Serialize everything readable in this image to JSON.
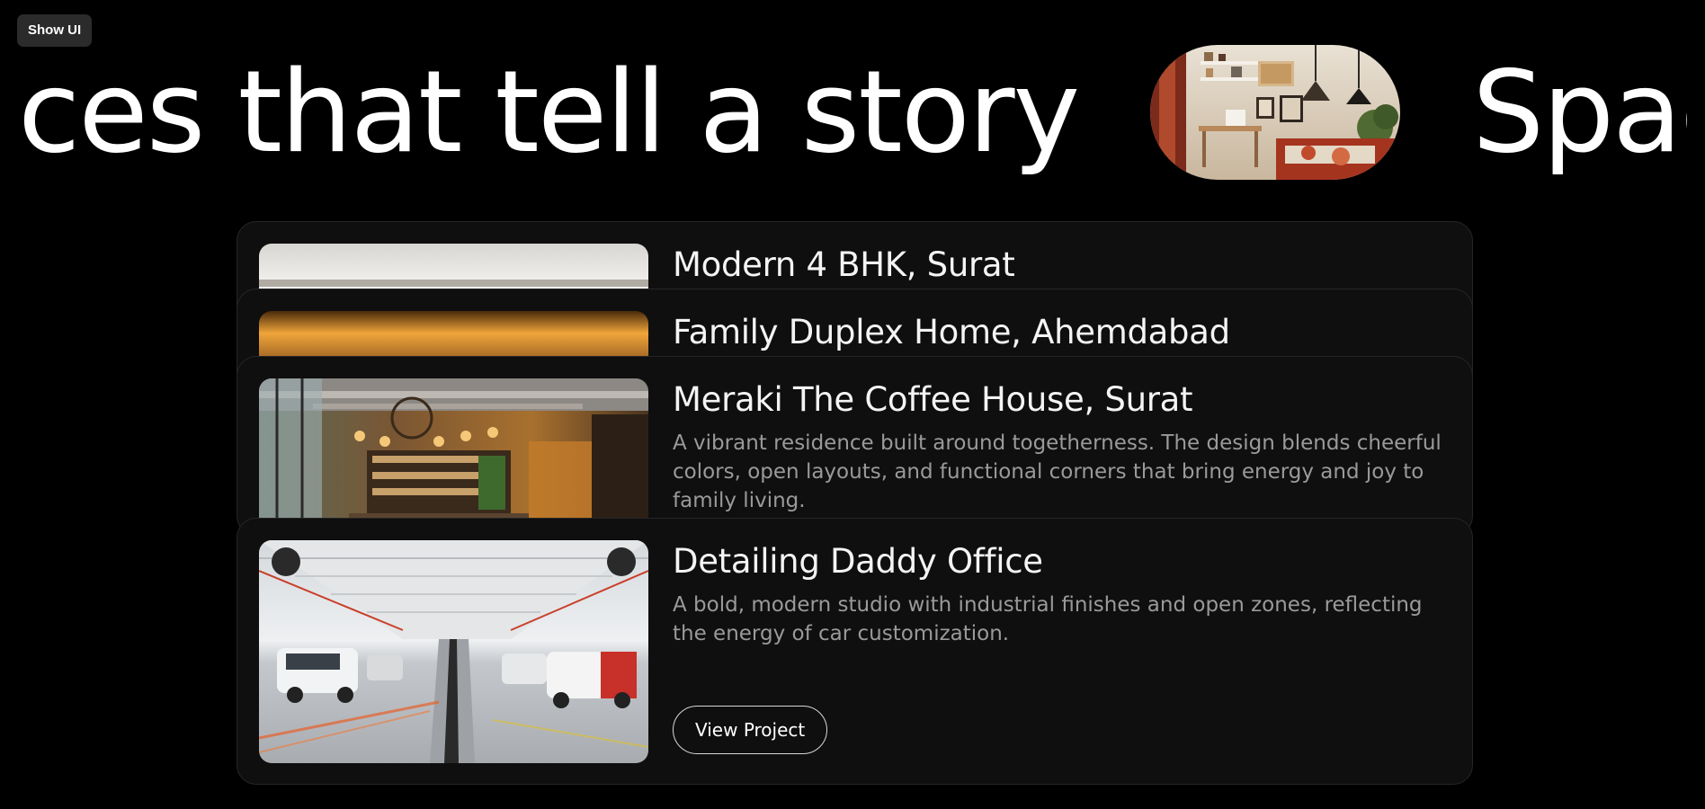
{
  "toolbar": {
    "show_ui_label": "Show UI"
  },
  "hero": {
    "marquee_text_1": "ces that tell a story",
    "marquee_text_2": "Spac",
    "pill_image": "bedroom-interior-photo"
  },
  "projects": [
    {
      "title": "Modern 4 BHK, Surat",
      "thumbnail": "bright-interior-ceiling-photo"
    },
    {
      "title": "Family Duplex Home, Ahemdabad",
      "thumbnail": "warm-lit-ceiling-photo"
    },
    {
      "title": "Meraki The Coffee House, Surat",
      "description": "A vibrant residence built around togetherness. The design blends cheerful colors, open layouts, and functional corners that bring energy and joy to family living.",
      "thumbnail": "coffee-house-interior-photo"
    },
    {
      "title": "Detailing Daddy Office",
      "description": "A bold, modern studio with industrial finishes and open zones, reflecting the energy of car customization.",
      "button_label": "View Project",
      "thumbnail": "car-workshop-interior-photo"
    }
  ],
  "colors": {
    "background": "#000000",
    "card": "#0f0f0f",
    "card_border": "#262626",
    "title": "#f4f4f4",
    "description": "#9a9a9a"
  }
}
